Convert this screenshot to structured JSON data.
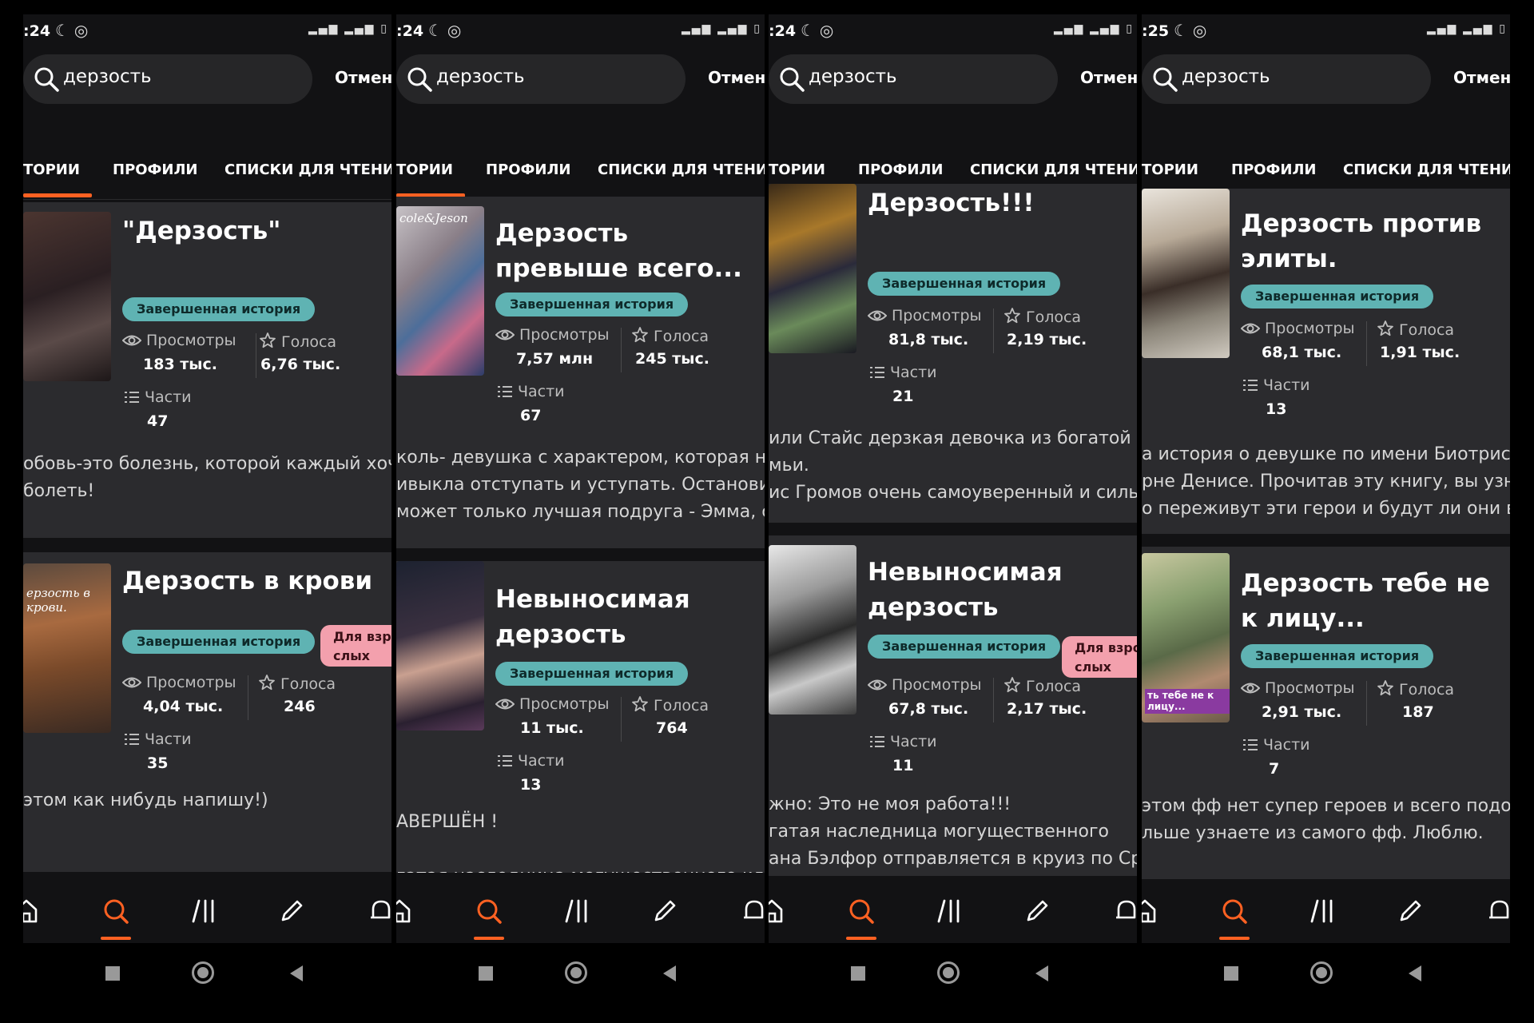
{
  "shared": {
    "search_value": "дерзость",
    "cancel_label": "Отмени",
    "tabs": [
      "ТОРИИ",
      "ПРОФИЛИ",
      "СПИСКИ ДЛЯ ЧТЕНИЯ"
    ],
    "badge_completed": "Завершенная история",
    "badge_adult": "Для взрос слых",
    "views_label": "Просмотры",
    "votes_label": "Голоса",
    "parts_label": "Части",
    "accent_color": "#ff6122",
    "badge_color": "#5fb3b3",
    "adult_badge_color": "#f3a0ad"
  },
  "panels": [
    {
      "time": ":24",
      "cards": [
        {
          "title": "\"Дерзость\"",
          "views": "183 тыс.",
          "votes": "6,76 тыс.",
          "parts": "47",
          "description": [
            "обовь-это болезнь, которой каждый хочет",
            "болеть!"
          ],
          "adult": false
        },
        {
          "title": "Дерзость в крови",
          "cover_text": "ерзость в крови.",
          "views": "4,04 тыс.",
          "votes": "246",
          "parts": "35",
          "description": [
            "этом как нибудь напишу!)"
          ],
          "adult": true
        }
      ]
    },
    {
      "time": ":24",
      "cards": [
        {
          "title": "Дерзость превыше всего...",
          "cover_text": "cole&Jeson",
          "views": "7,57 млн",
          "votes": "245 тыс.",
          "parts": "67",
          "description": [
            "коль- девушка с характером, которая не",
            "ивыкла отступать и уступать. Остановить",
            "может только лучшая подруга - Эмма, с ко"
          ],
          "adult": false
        },
        {
          "title": "Невыносимая дерзость",
          "views": "11 тыс.",
          "votes": "764",
          "parts": "13",
          "description": [
            "АВЕРШЁН !",
            "",
            "гатая наследница могущественного клан."
          ],
          "adult": false
        }
      ]
    },
    {
      "time": ":24",
      "cards": [
        {
          "title": "Дерзость!!!",
          "views": "81,8 тыс.",
          "votes": "2,19 тыс.",
          "parts": "21",
          "description": [
            "или Стайс дерзкая девочка из богатой",
            "мьи.",
            "ис  Громов очень самоуверенный и  сильн"
          ],
          "adult": false
        },
        {
          "title": "Невыносимая дерзость",
          "views": "67,8 тыс.",
          "votes": "2,17 тыс.",
          "parts": "11",
          "description": [
            "жно: Это не моя работа!!!",
            "гатая наследница могущественного",
            "ана Бэлфор отправляется в круиз по Сред"
          ],
          "adult": true
        }
      ]
    },
    {
      "time": ":25",
      "cards": [
        {
          "title": "Дерзость против элиты.",
          "views": "68,1 тыс.",
          "votes": "1,91 тыс.",
          "parts": "13",
          "description": [
            "а история о девушке по имени Биотрисс и",
            "рне Денисе. Прочитав эту книгу, вы узнает",
            "о переживут эти герои и будут ли они вме."
          ],
          "adult": false
        },
        {
          "title": "Дерзость тебе не к лицу...",
          "cover_text": "ть тебе не к лицу...",
          "views": "2,91 тыс.",
          "votes": "187",
          "parts": "7",
          "description": [
            "этом фф нет супер героев и всего подобно",
            "льше узнаете из самого фф. Люблю."
          ],
          "adult": false
        }
      ]
    }
  ]
}
